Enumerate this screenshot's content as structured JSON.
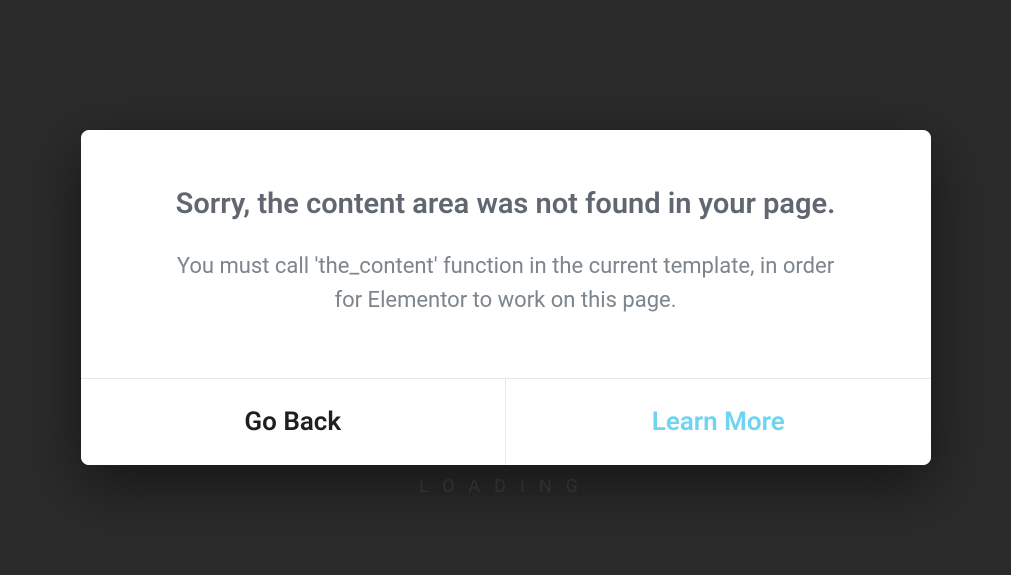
{
  "backdrop": {
    "loading_text": "LOADING"
  },
  "modal": {
    "title": "Sorry, the content area was not found in your page.",
    "message": "You must call 'the_content' function in the current template, in order for Elementor to work on this page.",
    "buttons": {
      "back_label": "Go Back",
      "learn_label": "Learn More"
    }
  },
  "colors": {
    "background": "#2b2b2b",
    "modal_bg": "#ffffff",
    "title": "#606770",
    "message": "#7c848c",
    "btn_primary": "#1f1f1f",
    "btn_accent": "#6ed4f2"
  }
}
